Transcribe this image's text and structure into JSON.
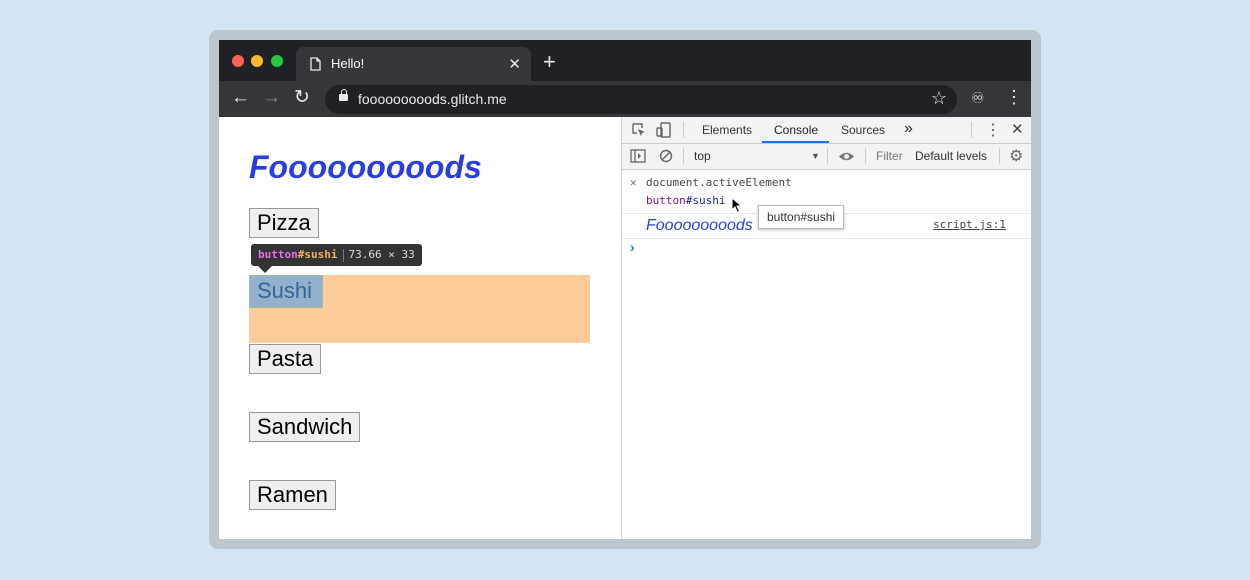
{
  "browser": {
    "tab_title": "Hello!",
    "tab_close": "✕",
    "new_tab": "+",
    "url": "fooooooooods.glitch.me"
  },
  "page": {
    "heading": "Fooooooooods",
    "buttons": [
      "Pizza",
      "Sushi",
      "Pasta",
      "Sandwich",
      "Ramen"
    ],
    "inspect_tooltip": {
      "tag": "button",
      "id": "#sushi",
      "size": "73.66 × 33"
    }
  },
  "devtools": {
    "tabs": [
      "Elements",
      "Console",
      "Sources"
    ],
    "active_tab": "Console",
    "more_tabs": "»",
    "context": "top",
    "filter_placeholder": "Filter",
    "levels": "Default levels",
    "console": {
      "command": "document.activeElement",
      "result_tag": "button",
      "result_id": "#sushi",
      "hover_hint": "button#sushi",
      "log_text": "Fooooooooods",
      "log_source": "script.js:1",
      "prompt": "›"
    }
  },
  "colors": {
    "heading": "#2a3ee0",
    "highlight_margin": "#fecb9a",
    "highlight_element": "#6fa8dc",
    "tab_accent": "#1a73e8"
  }
}
